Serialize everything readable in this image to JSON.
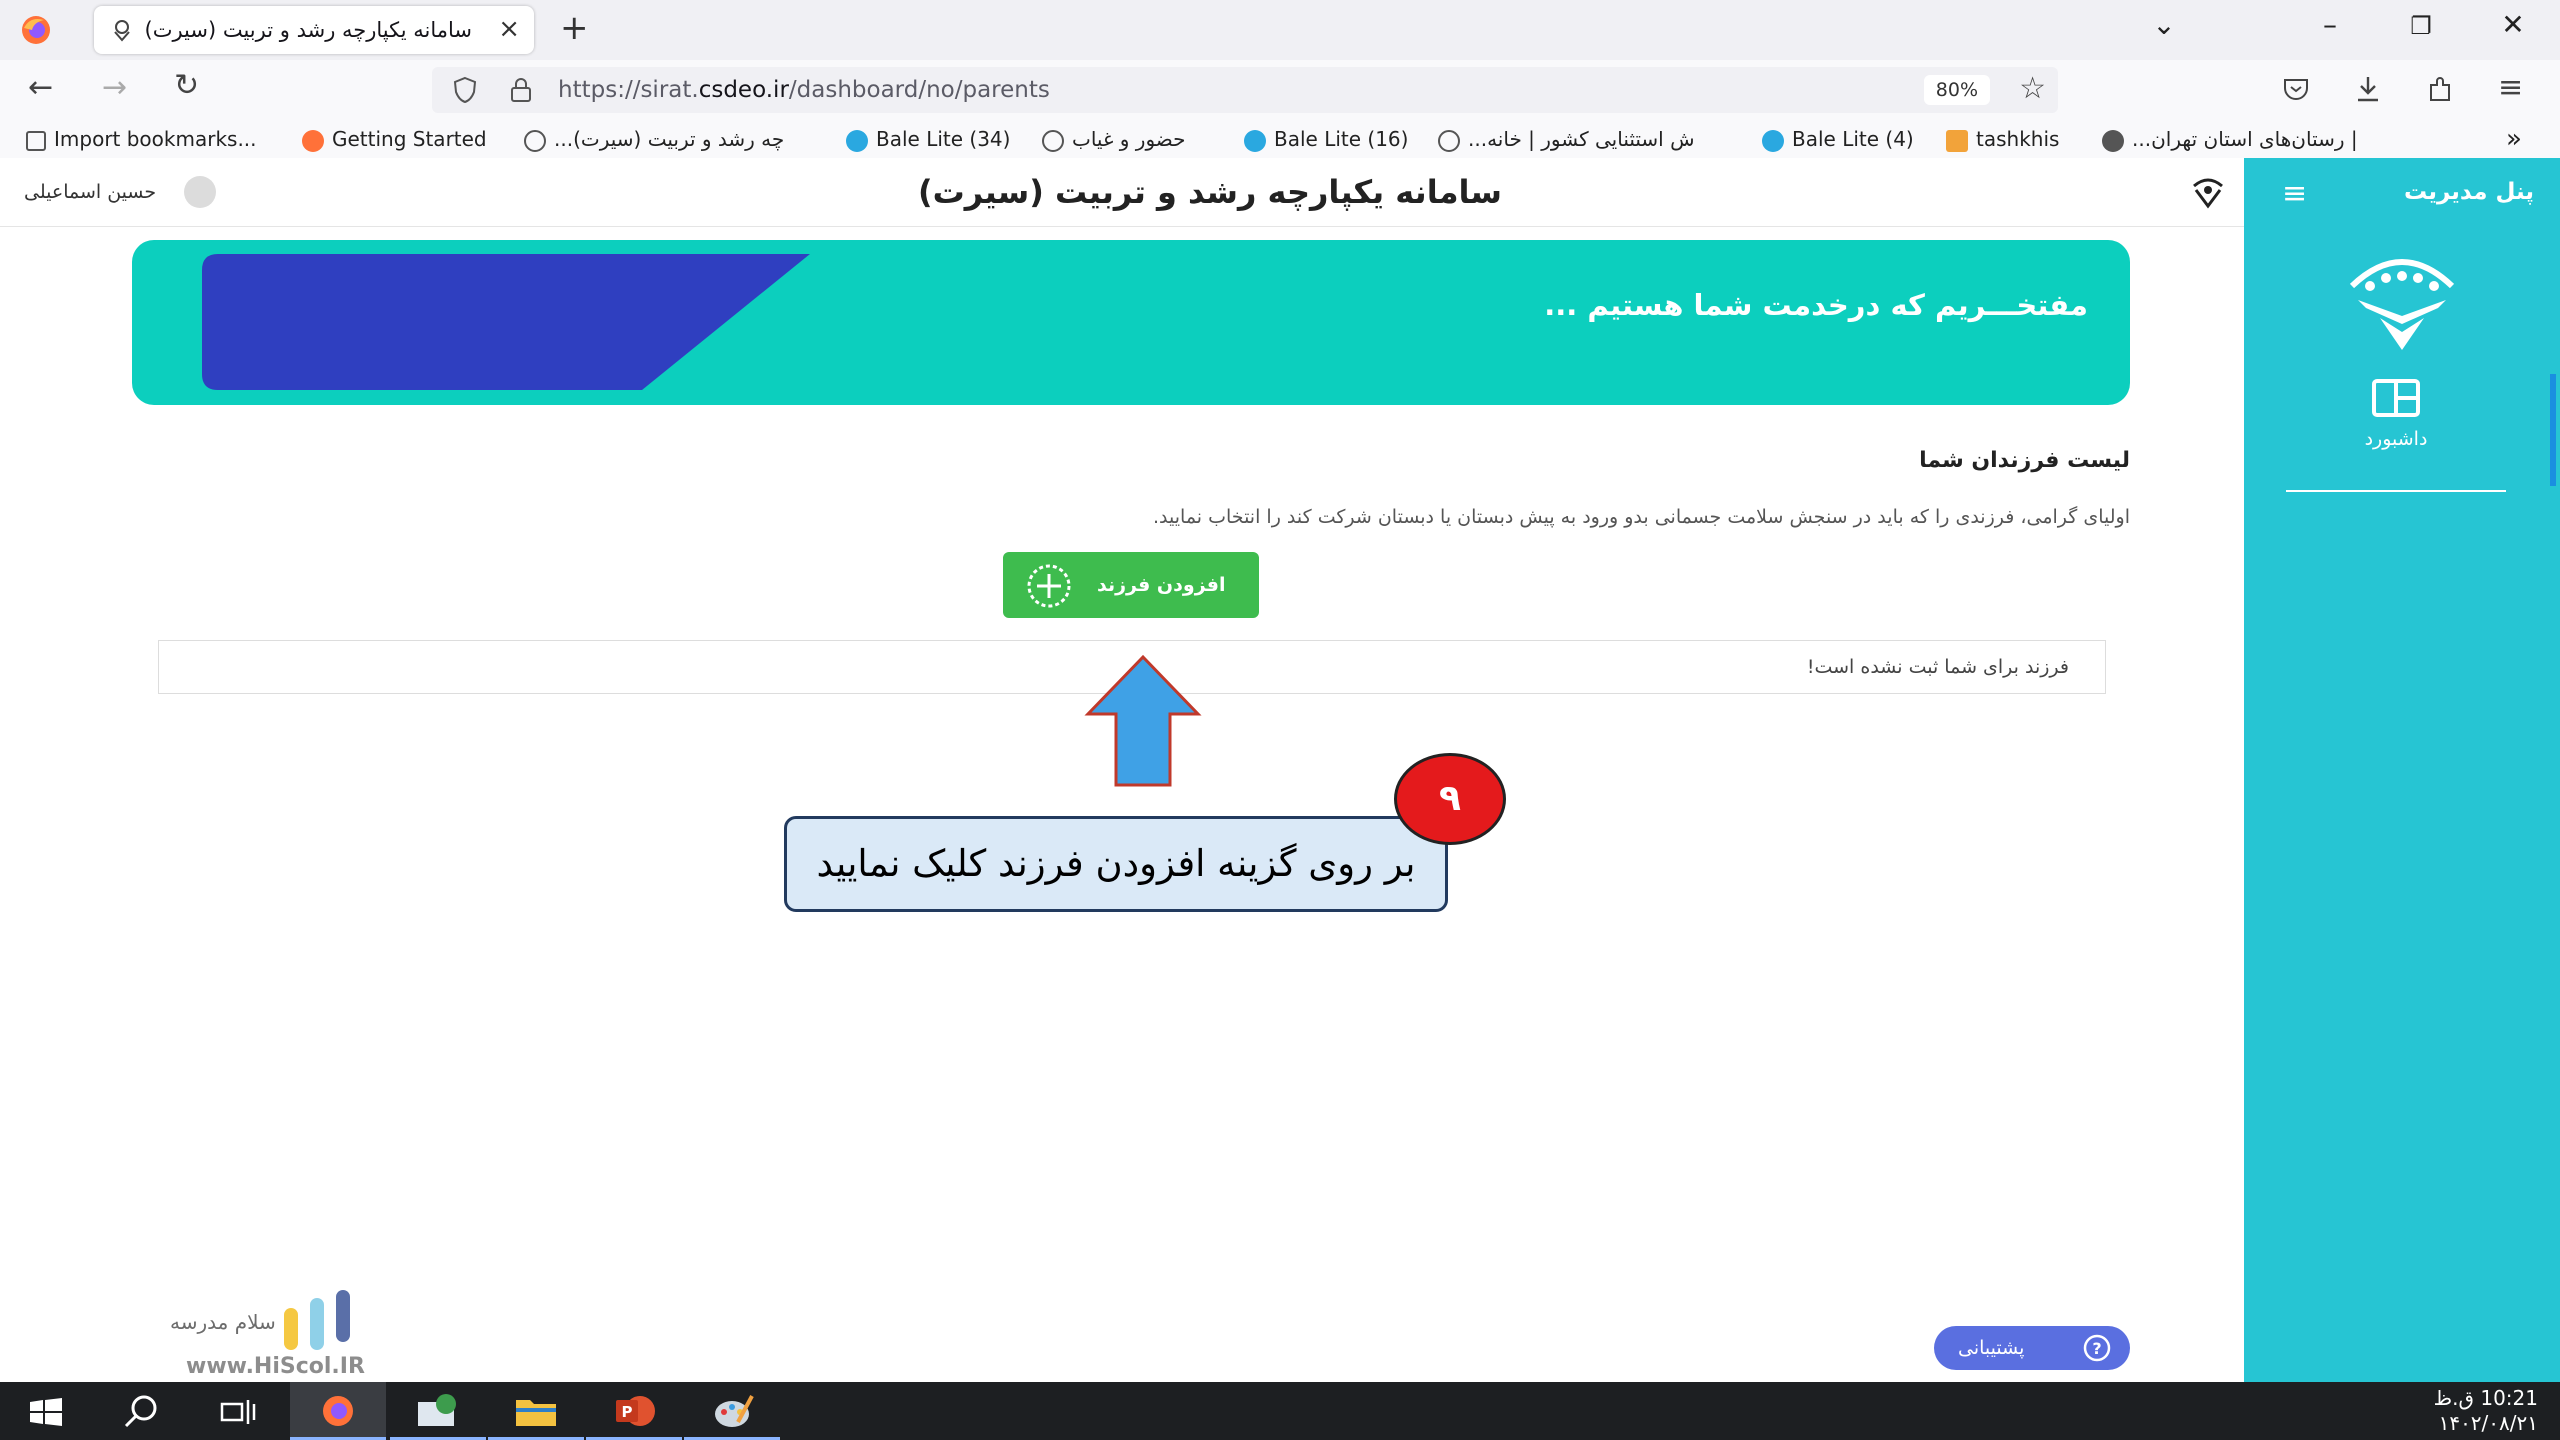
{
  "browser": {
    "tab_title": "سامانه یکپارچه رشد و تربیت (سیرت)",
    "new_tab": "+",
    "url_prefix": "https://sirat.",
    "url_domain": "csdeo.ir",
    "url_path": "/dashboard/no/parents",
    "zoom": "80%",
    "bookmarks": [
      "Import bookmarks...",
      "Getting Started",
      "...چه رشد و تربیت (سیرت)",
      "Bale Lite (34)",
      "حضور و غیاب",
      "Bale Lite (16)",
      "...ش استثنایی کشور | خانه",
      "Bale Lite (4)",
      "tashkhis",
      "...رستان‌های استان تهران |"
    ]
  },
  "header": {
    "title": "سامانه یکپارچه رشد و تربیت (سیرت)",
    "user_name": "حسین اسماعیلی"
  },
  "sidebar": {
    "title": "پنل مدیریت",
    "items": [
      {
        "label": "داشبورد"
      }
    ]
  },
  "banner": {
    "text": "مفتخـــریم که درخدمت شما هستیم ..."
  },
  "children": {
    "title": "لیست فرزندان شما",
    "description": "اولیای گرامی، فرزندی را که باید در سنجش سلامت جسمانی بدو ورود به پیش دبستان یا دبستان شرکت کند را انتخاب نمایید.",
    "add_button": "افزودن فرزند",
    "empty_message": "فرزند برای شما ثبت نشده است!"
  },
  "annotation": {
    "step": "۹",
    "text": "بر روی گزینه افزودن فرزند کلیک نمایید"
  },
  "support": {
    "label": "پشتیبانی"
  },
  "watermark": {
    "name": "سلام مدرسه",
    "url": "www.HiScol.IR"
  },
  "taskbar": {
    "time": "10:21 ق.ظ",
    "date": "۱۴۰۲/۰۸/۲۱"
  },
  "colors": {
    "sidebar": "#26c5d3",
    "banner": "#0ccfbe",
    "banner_shape": "#2f3fc0",
    "add_button": "#3ebc4e",
    "support": "#5a6fe0",
    "arrow": "#3fa1e6",
    "badge": "#e41a1c"
  }
}
